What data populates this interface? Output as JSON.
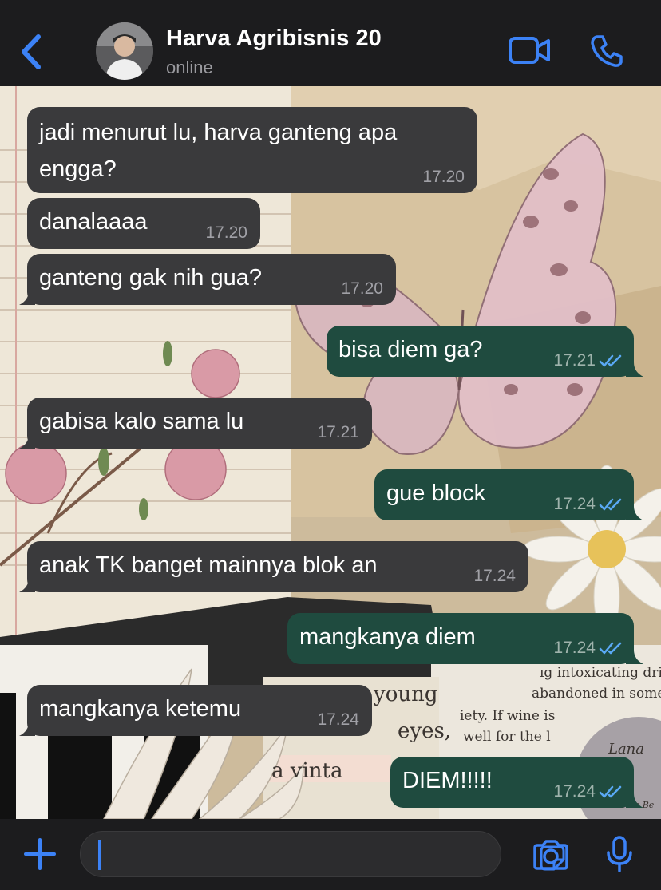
{
  "header": {
    "contact_name": "Harva Agribisnis 20",
    "status": "online"
  },
  "colors": {
    "accent": "#3c82f6",
    "incoming_bubble": "#3a3a3c",
    "outgoing_bubble": "#1f4b3f",
    "read_ticks": "#5aa9f5"
  },
  "messages": [
    {
      "direction": "incoming",
      "lines": [
        "jadi menurut lu, harva ganteng apa",
        "engga?"
      ],
      "time": "17.20"
    },
    {
      "direction": "incoming",
      "lines": [
        "danalaaaa"
      ],
      "time": "17.20"
    },
    {
      "direction": "incoming",
      "lines": [
        "ganteng gak nih gua?"
      ],
      "time": "17.20"
    },
    {
      "direction": "outgoing",
      "lines": [
        "bisa diem ga?"
      ],
      "time": "17.21",
      "status": "read"
    },
    {
      "direction": "incoming",
      "lines": [
        "gabisa kalo sama lu"
      ],
      "time": "17.21"
    },
    {
      "direction": "outgoing",
      "lines": [
        "gue block"
      ],
      "time": "17.24",
      "status": "read"
    },
    {
      "direction": "incoming",
      "lines": [
        "anak TK banget mainnya blok an"
      ],
      "time": "17.24"
    },
    {
      "direction": "outgoing",
      "lines": [
        "mangkanya diem"
      ],
      "time": "17.24",
      "status": "read"
    },
    {
      "direction": "incoming",
      "lines": [
        "mangkanya ketemu"
      ],
      "time": "17.24"
    },
    {
      "direction": "outgoing",
      "lines": [
        "DIEM!!!!!"
      ],
      "time": "17.24",
      "status": "read"
    }
  ],
  "wallpaper": {
    "texts": [
      "ıg intoxicating dri",
      "abandoned in some o",
      "iety.  If wine is",
      "well for the l",
      "young",
      "eyes,",
      "a vinta",
      "Lana",
      "Blue Be"
    ]
  },
  "icons": {
    "back": "chevron-left-icon",
    "video": "video-camera-icon",
    "call": "phone-icon",
    "attach": "plus-icon",
    "sticker": "sticker-icon",
    "camera": "camera-icon",
    "mic": "microphone-icon"
  }
}
